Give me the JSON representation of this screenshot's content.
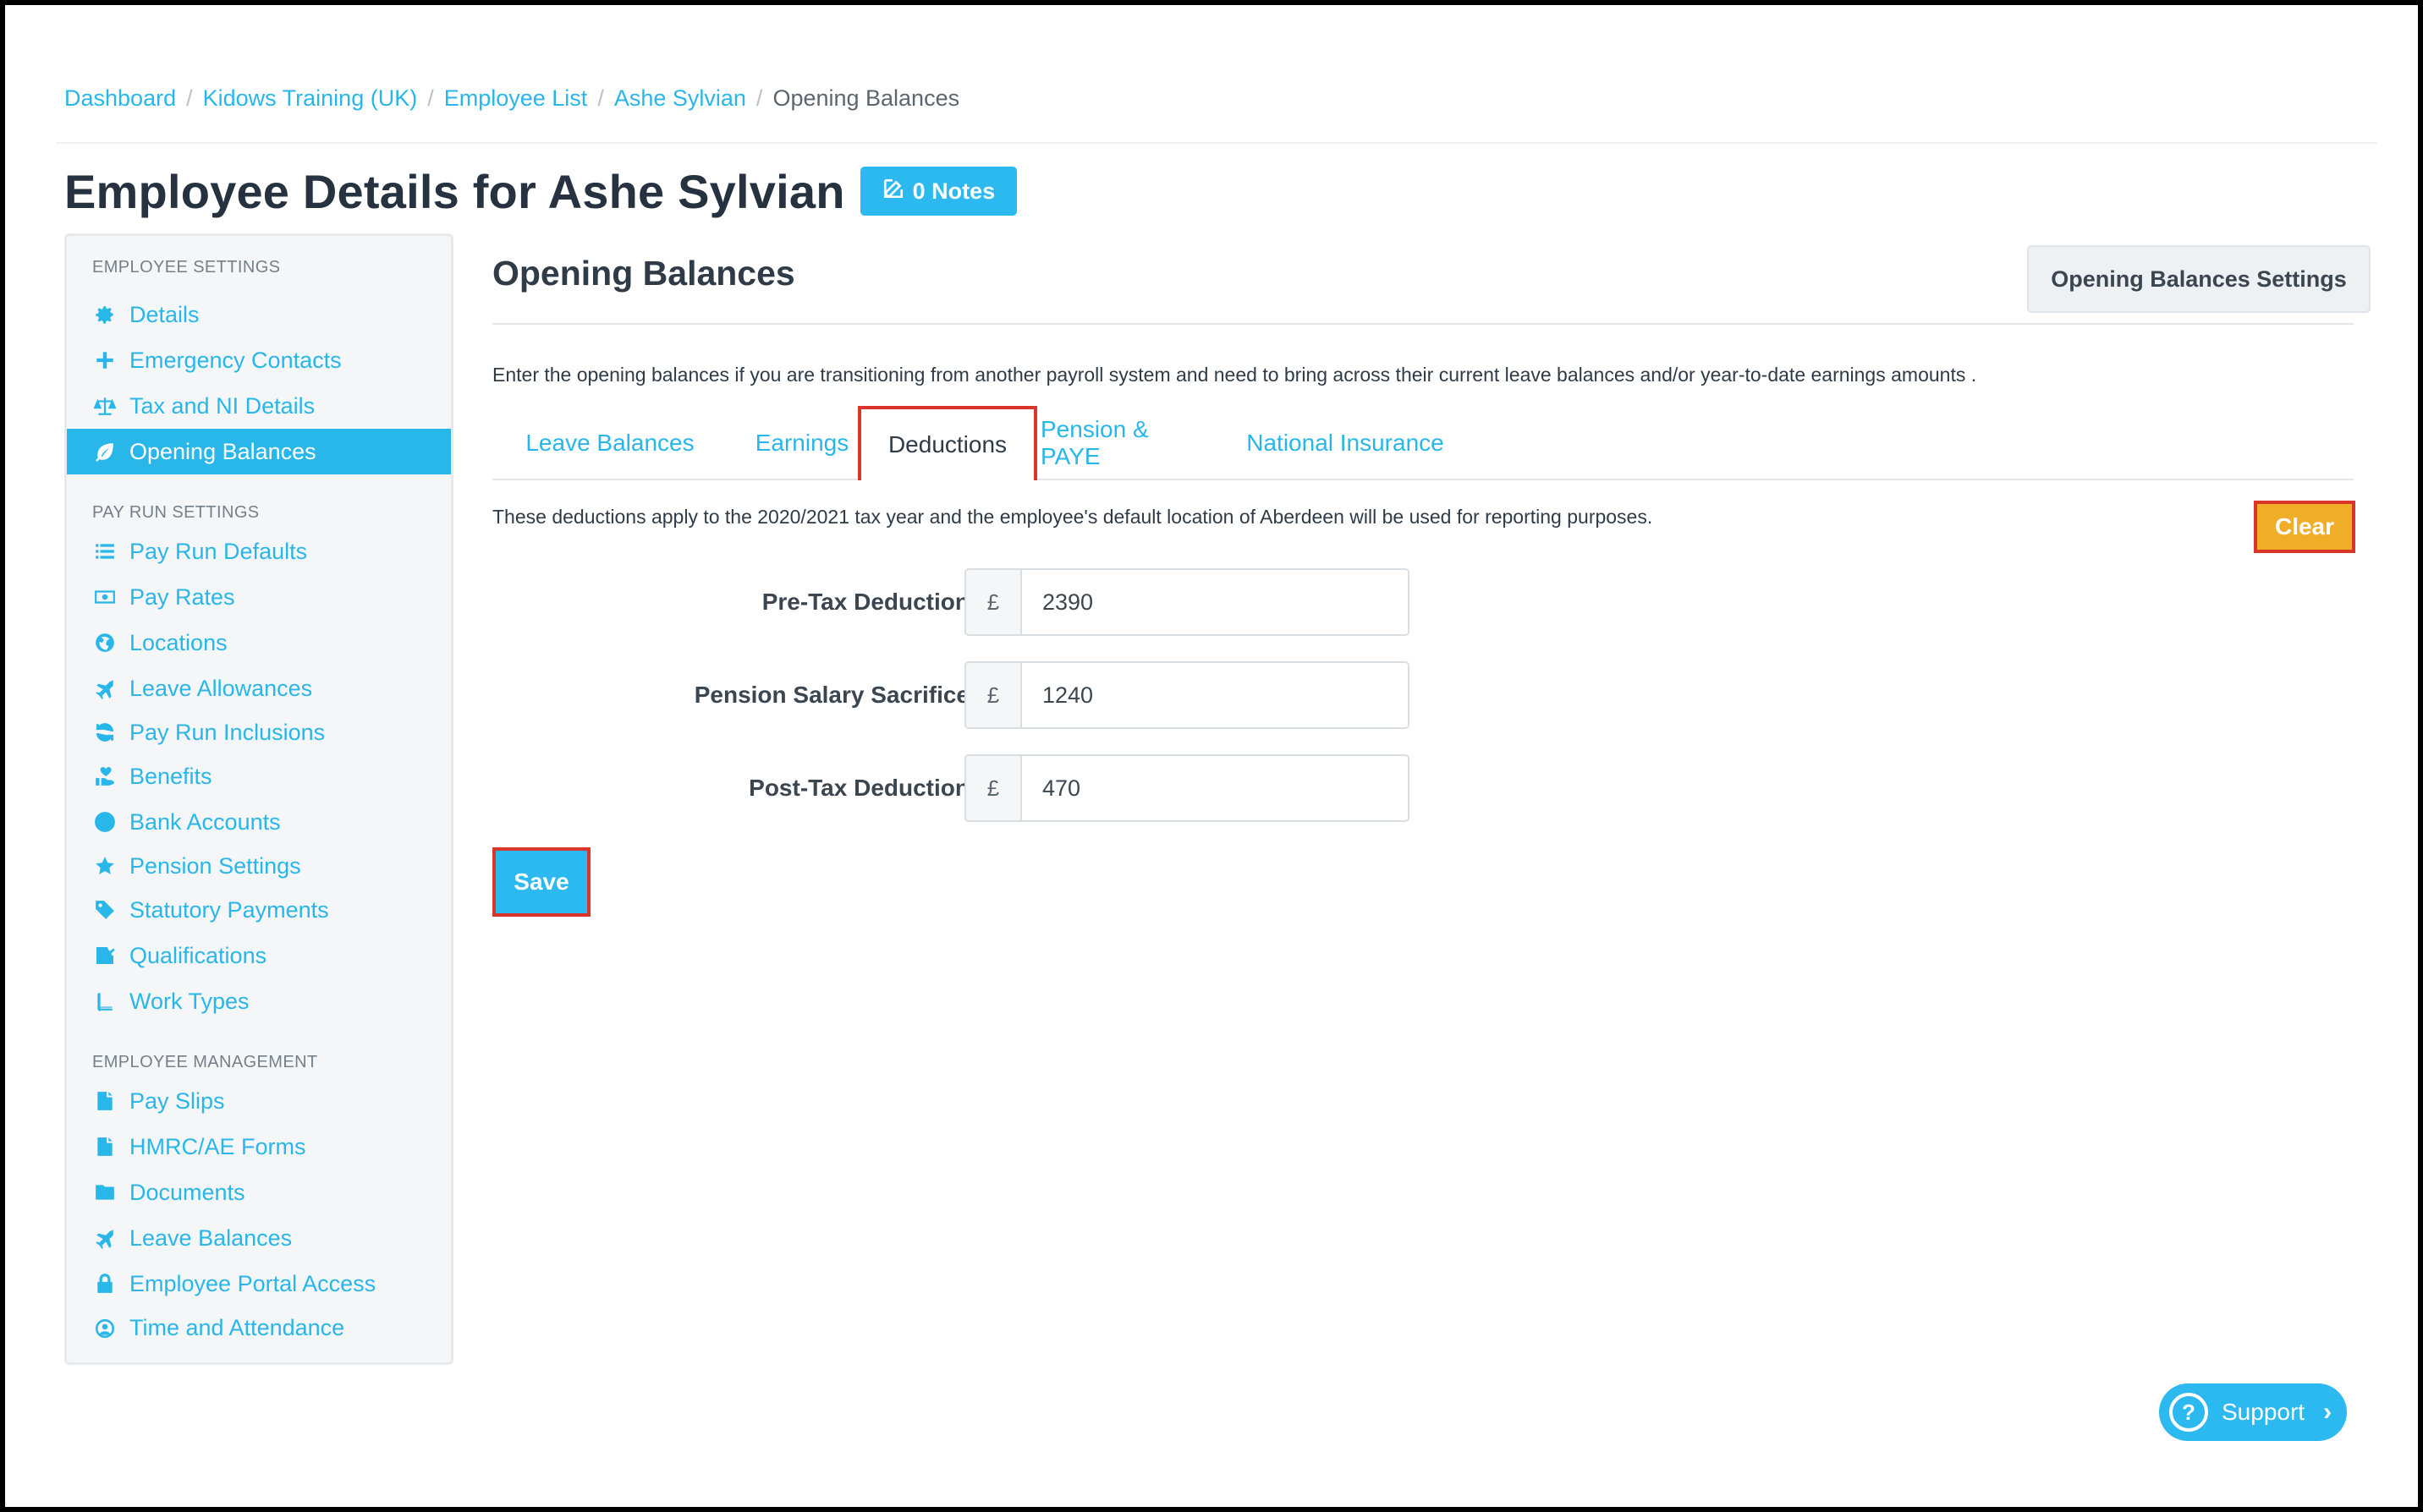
{
  "breadcrumb": {
    "items": [
      "Dashboard",
      "Kidows Training (UK)",
      "Employee List",
      "Ashe Sylvian"
    ],
    "current": "Opening Balances"
  },
  "header": {
    "title": "Employee Details for Ashe Sylvian",
    "notes_label": "0 Notes"
  },
  "sidebar": {
    "sections": [
      {
        "heading": "EMPLOYEE SETTINGS",
        "items": [
          {
            "label": "Details",
            "icon": "gear-icon"
          },
          {
            "label": "Emergency Contacts",
            "icon": "plus-icon"
          },
          {
            "label": "Tax and NI Details",
            "icon": "scale-icon"
          },
          {
            "label": "Opening Balances",
            "icon": "leaf-icon",
            "active": true
          }
        ]
      },
      {
        "heading": "PAY RUN SETTINGS",
        "items": [
          {
            "label": "Pay Run Defaults",
            "icon": "list-icon"
          },
          {
            "label": "Pay Rates",
            "icon": "money-icon"
          },
          {
            "label": "Locations",
            "icon": "globe-icon"
          },
          {
            "label": "Leave Allowances",
            "icon": "plane-icon"
          },
          {
            "label": "Pay Run Inclusions",
            "icon": "refresh-icon"
          },
          {
            "label": "Benefits",
            "icon": "hand-heart-icon"
          },
          {
            "label": "Bank Accounts",
            "icon": "dollar-circle-icon"
          },
          {
            "label": "Pension Settings",
            "icon": "star-icon"
          },
          {
            "label": "Statutory Payments",
            "icon": "tag-icon"
          },
          {
            "label": "Qualifications",
            "icon": "check-square-icon"
          },
          {
            "label": "Work Types",
            "icon": "book-icon"
          }
        ]
      },
      {
        "heading": "EMPLOYEE MANAGEMENT",
        "items": [
          {
            "label": "Pay Slips",
            "icon": "file-icon"
          },
          {
            "label": "HMRC/AE Forms",
            "icon": "file-icon"
          },
          {
            "label": "Documents",
            "icon": "folder-icon"
          },
          {
            "label": "Leave Balances",
            "icon": "plane-icon"
          },
          {
            "label": "Employee Portal Access",
            "icon": "lock-icon"
          },
          {
            "label": "Time and Attendance",
            "icon": "user-clock-icon"
          }
        ]
      }
    ]
  },
  "main": {
    "section_title": "Opening Balances",
    "settings_button": "Opening Balances Settings",
    "intro": "Enter the opening balances if you are transitioning from another payroll system and need to bring across their current leave balances and/or year-to-date earnings amounts .",
    "tabs": [
      {
        "label": "Leave Balances"
      },
      {
        "label": "Earnings"
      },
      {
        "label": "Deductions",
        "active": true
      },
      {
        "label": "Pension & PAYE"
      },
      {
        "label": "National Insurance"
      }
    ],
    "deductions_note": "These deductions apply to the 2020/2021 tax year and the employee's default location of Aberdeen will be used for reporting purposes.",
    "clear_label": "Clear",
    "fields": [
      {
        "label": "Pre-Tax Deduction",
        "currency": "£",
        "value": "2390"
      },
      {
        "label": "Pension Salary Sacrifice",
        "currency": "£",
        "value": "1240"
      },
      {
        "label": "Post-Tax Deduction",
        "currency": "£",
        "value": "470"
      }
    ],
    "save_label": "Save"
  },
  "support": {
    "label": "Support"
  },
  "colors": {
    "accent": "#29b6e8",
    "warning": "#f0ad28",
    "highlight_border": "#d9352b"
  }
}
